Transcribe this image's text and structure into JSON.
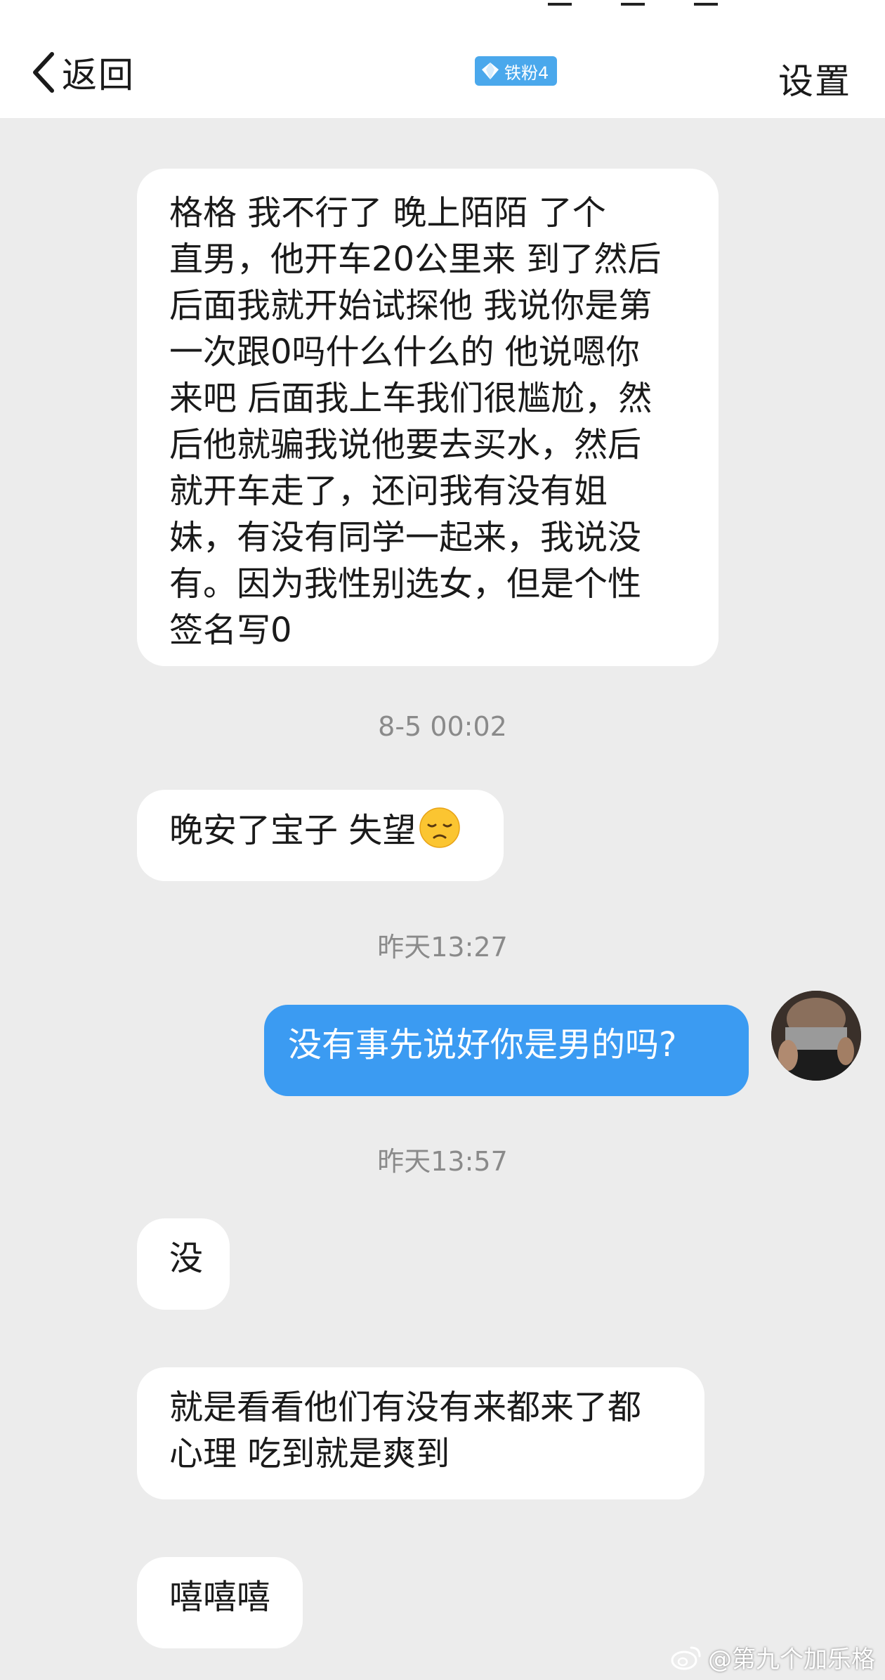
{
  "header": {
    "back_label": "返回",
    "badge_label": "铁粉4",
    "settings_label": "设置"
  },
  "messages": [
    {
      "side": "in",
      "lines": [
        "格格 我不行了 晚上陌陌  了个",
        "直男，他开车20公里来 到了然后",
        "后面我就开始试探他 我说你是第",
        "一次跟0吗什么什么的 他说嗯你",
        "来吧 后面我上车我们很尴尬，然",
        "后他就骗我说他要去买水，然后",
        "就开车走了，还问我有没有姐",
        "妹，有没有同学一起来，我说没",
        "有。因为我性别选女，但是个性",
        "签名写0"
      ]
    },
    {
      "time": "8-5 00:02"
    },
    {
      "side": "in",
      "text": "晚安了宝子 失望",
      "emoji": "disappointed-face"
    },
    {
      "time": "昨天13:27"
    },
    {
      "side": "out",
      "text": "没有事先说好你是男的吗?"
    },
    {
      "time": "昨天13:57"
    },
    {
      "side": "in",
      "text": "没"
    },
    {
      "side": "in",
      "lines": [
        "就是看看他们有没有来都来了都",
        "心理 吃到就是爽到"
      ]
    },
    {
      "side": "in",
      "text": "嘻嘻嘻"
    }
  ],
  "watermark": "@第九个加乐格",
  "colors": {
    "background": "#ececec",
    "outgoing_bubble": "#3b9bf2",
    "badge": "#4aa8ec",
    "timestamp": "#8a8a8a"
  }
}
